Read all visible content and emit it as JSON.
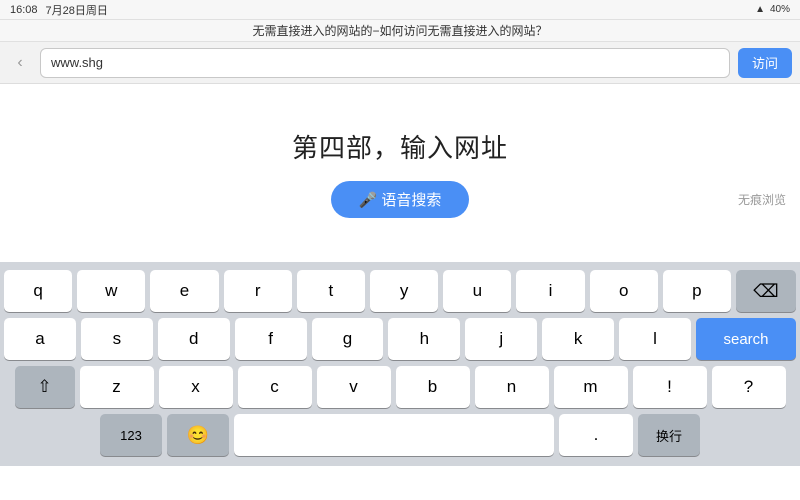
{
  "statusBar": {
    "time": "16:08",
    "date": "7月28日周日",
    "batteryLevel": "40%",
    "batteryIcon": "🔋"
  },
  "browserBar": {
    "backLabel": "‹",
    "urlValue": "www.shg",
    "visitLabel": "访问"
  },
  "titleBar": {
    "pageTitle": "无需直接进入的网站的−如何访问无需直接进入的网站？"
  },
  "mainContent": {
    "heading": "第四部，输入网址",
    "voiceSearchLabel": "🎤 语音搜索",
    "incognitoLabel": "无痕浏览"
  },
  "keyboard": {
    "row1": [
      "q",
      "w",
      "e",
      "r",
      "t",
      "y",
      "u",
      "i",
      "o",
      "p"
    ],
    "row2": [
      "a",
      "s",
      "d",
      "f",
      "g",
      "h",
      "j",
      "k",
      "l"
    ],
    "row3": [
      "z",
      "x",
      "c",
      "v",
      "b",
      "n",
      "m"
    ],
    "searchLabel": "search",
    "backspaceSymbol": "⌫",
    "shiftSymbol": "⇧",
    "spaceLabel": "",
    "returnLabel": "换行",
    "numbersLabel": "123",
    "emojiLabel": "😊"
  }
}
